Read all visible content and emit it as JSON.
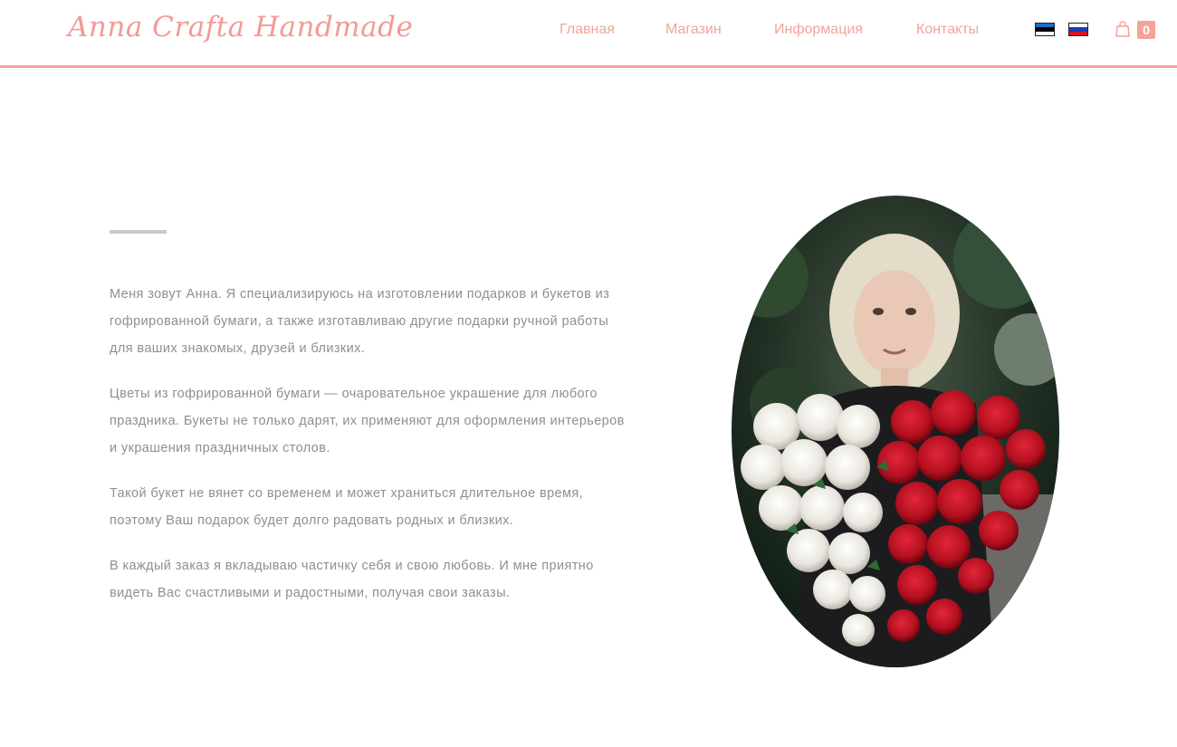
{
  "header": {
    "logo": "Anna Crafta Handmade",
    "nav": {
      "home": "Главная",
      "shop": "Магазин",
      "info": "Информация",
      "contacts": "Контакты"
    },
    "languages": [
      {
        "code": "et",
        "icon": "estonia-flag-icon"
      },
      {
        "code": "ru",
        "icon": "russia-flag-icon"
      }
    ],
    "cart": {
      "icon": "shopping-bag-icon",
      "count": "0"
    }
  },
  "colors": {
    "accent": "#f5a39a",
    "text": "#8f8f8f",
    "divider": "#c9c9c9"
  },
  "about": {
    "paragraphs": [
      "Меня зовут Анна. Я специализируюсь на изготовлении подарков и букетов из гофрированной бумаги, а также изготавливаю другие подарки ручной работы для ваших знакомых, друзей и близких.",
      "Цветы из гофрированной бумаги — очаровательное украшение для любого праздника. Букеты не только дарят, их применяют для оформления интерьеров и украшения праздничных столов.",
      "Такой букет не вянет со временем и может храниться длительное время, поэтому Ваш подарок будет долго радовать родных и близких.",
      "В каждый заказ я вкладываю частичку себя и свою любовь. И мне приятно видеть Вас счастливыми и радостными, получая свои заказы."
    ]
  }
}
